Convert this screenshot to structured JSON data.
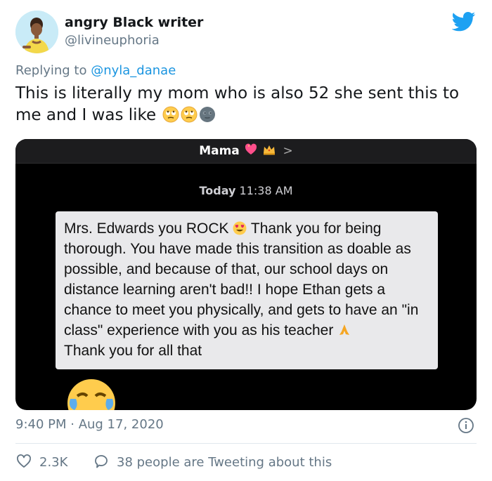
{
  "author": {
    "name": "angry Black writer",
    "handle": "@livineuphoria",
    "avatar_icon": "profile-illustration",
    "verified_brand_icon": "twitter-bird-icon"
  },
  "reply": {
    "prefix": "Replying to",
    "to": "@nyla_danae"
  },
  "tweet": {
    "text": "This is literally my mom who is also 52 she sent this to me and I was like",
    "trailing_emojis": [
      "face-with-rolling-eyes",
      "face-with-rolling-eyes",
      "new-moon-face"
    ]
  },
  "media": {
    "contact_name": "Mama",
    "contact_emojis": [
      "sparkling-heart",
      "crown"
    ],
    "contact_chevron": ">",
    "timestamp_day": "Today",
    "timestamp_time": "11:38 AM",
    "message_part1": "Mrs. Edwards you ROCK",
    "message_part2": "Thank you for being thorough. You have made this transition as doable as possible, and because of that, our school days on distance learning aren't bad!! I hope Ethan gets a chance to meet you physically, and gets to have an \"in class\" experience with you as his teacher",
    "message_part3": "Thank you for all that",
    "bottom_emoji": "face-with-tears-of-joy"
  },
  "meta": {
    "time": "9:40 PM · Aug 17, 2020"
  },
  "stats": {
    "likes": "2.3K",
    "replies_text": "38 people are Tweeting about this"
  },
  "colors": {
    "twitter_blue": "#1da1f2",
    "secondary_text": "#657786",
    "link": "#1b95e0",
    "bubble_bg": "#e9e9eb"
  }
}
